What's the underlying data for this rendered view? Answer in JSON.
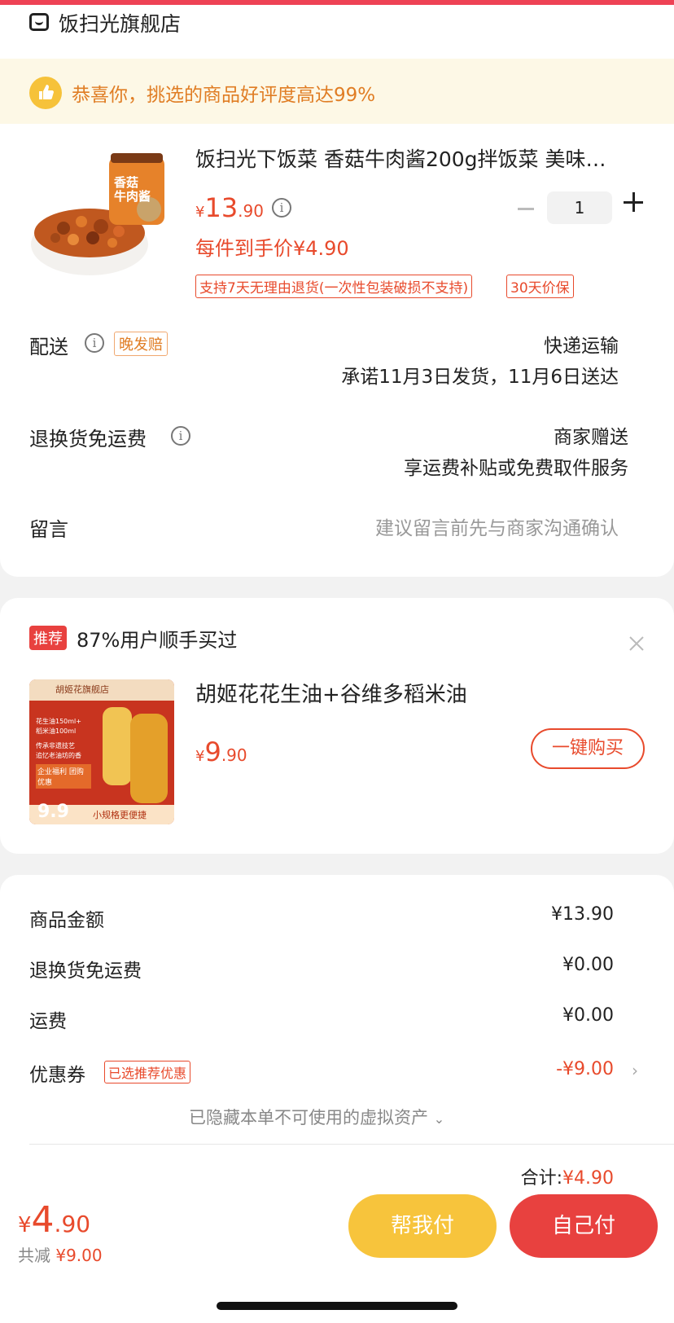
{
  "store": {
    "name": "饭扫光旗舰店"
  },
  "banner": {
    "text": "恭喜你，挑选的商品好评度高达99%"
  },
  "product": {
    "title": "饭扫光下饭菜 香菇牛肉酱200g拌饭菜 美味…",
    "image_label_line1": "香菇",
    "image_label_line2": "牛肉酱",
    "price_symbol": "¥",
    "price_int": "13",
    "price_dec": ".90",
    "unit_price": "每件到手价¥4.90",
    "quantity": "1",
    "tags": [
      "支持7天无理由退货(一次性包装破损不支持)",
      "30天价保"
    ]
  },
  "delivery": {
    "label": "配送",
    "badge": "晚发赔",
    "method": "快递运输",
    "promise": "承诺11月3日发货，11月6日送达"
  },
  "return_shipping": {
    "label": "退换货免运费",
    "value": "商家赠送",
    "sub": "享运费补贴或免费取件服务"
  },
  "message": {
    "label": "留言",
    "placeholder": "建议留言前先与商家沟通确认"
  },
  "recommend": {
    "badge": "推荐",
    "headline": "87%用户顺手买过",
    "title": "胡姬花花生油+谷维多稻米油",
    "price_symbol": "¥",
    "price_int": "9",
    "price_dec": ".90",
    "buy_label": "一键购买",
    "img_store": "胡姬花旗舰店",
    "img_lines": [
      "花生油150ml+",
      "稻米油100ml",
      "传承非遗技艺",
      "追忆老油坊的香"
    ],
    "img_promo": "企业福利 团购优惠",
    "img_caption": "小规格更便捷",
    "img_price": "9.9"
  },
  "summary": {
    "rows": [
      {
        "label": "商品金额",
        "value": "¥13.90"
      },
      {
        "label": "退换货免运费",
        "value": "¥0.00"
      },
      {
        "label": "运费",
        "value": "¥0.00"
      }
    ],
    "coupon_label": "优惠券",
    "coupon_badge": "已选推荐优惠",
    "coupon_value": "-¥9.00",
    "hidden_assets": "已隐藏本单不可使用的虚拟资产",
    "total_label": "合计:",
    "total_value": "¥4.90"
  },
  "footer": {
    "price_symbol": "¥",
    "price_int": "4",
    "price_dec": ".90",
    "saved_label": "共减",
    "saved_value": "¥9.00",
    "help_pay": "帮我付",
    "self_pay": "自己付"
  },
  "colors": {
    "accent": "#e84a2c",
    "yellow": "#f7c43c",
    "red_button": "#e8413f",
    "banner_bg": "#fdf8e6"
  }
}
